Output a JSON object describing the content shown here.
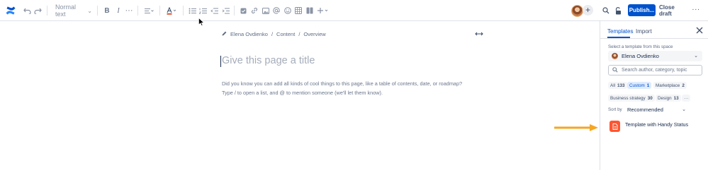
{
  "toolbar": {
    "text_style": "Normal text",
    "publish_label": "Publish...",
    "close_draft_label": "Close draft"
  },
  "breadcrumb": {
    "author": "Elena Ovdienko",
    "items": [
      "Content",
      "Overview"
    ]
  },
  "editor": {
    "title_placeholder": "Give this page a title",
    "hint_line1": "Did you know you can add all kinds of cool things to this page, like a table of contents, date, or roadmap?",
    "hint_line2": "Type / to open a list, and @ to mention someone (we'll let them know)."
  },
  "panel": {
    "tabs": [
      "Templates",
      "Import"
    ],
    "space_label": "Select a template from this space",
    "space_value": "Elena Ovdienko",
    "search_placeholder": "Search author, category, topic",
    "chips": [
      {
        "label": "All",
        "count": "133"
      },
      {
        "label": "Custom",
        "count": "1"
      },
      {
        "label": "Marketplace",
        "count": "2"
      },
      {
        "label": "Business strategy",
        "count": "30"
      },
      {
        "label": "Design",
        "count": "13"
      }
    ],
    "more_chip": "···",
    "sort_label": "Sort by",
    "sort_value": "Recommended",
    "template_name": "Template with Handy Status"
  },
  "colors": {
    "accent": "#0052cc",
    "template_icon": "#ff5630",
    "arrow": "#f6a623"
  }
}
